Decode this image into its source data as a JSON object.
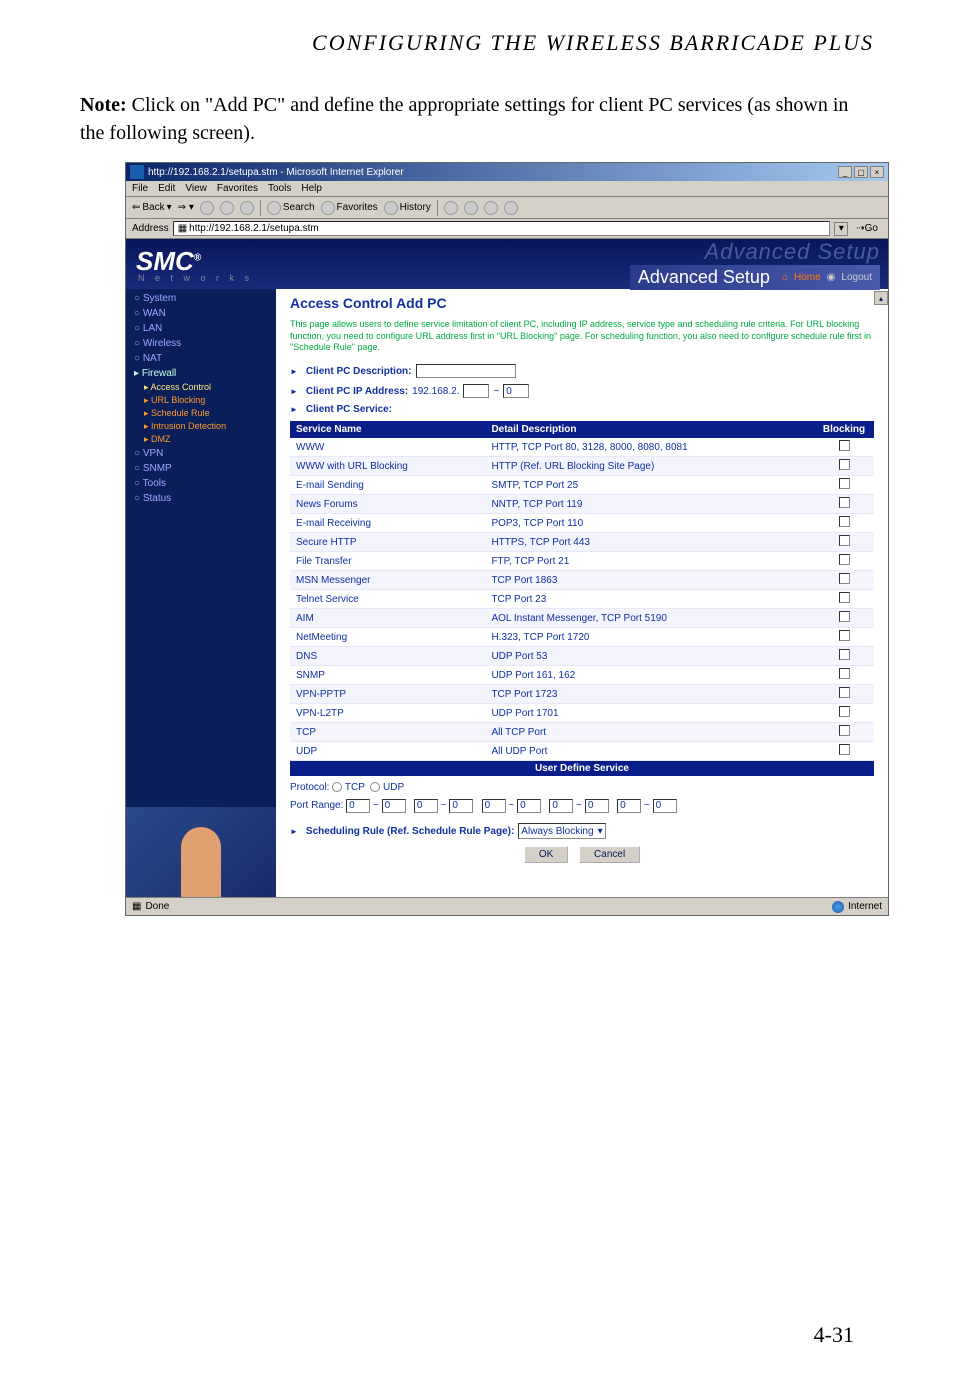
{
  "doc": {
    "header_title": "CONFIGURING THE WIRELESS BARRICADE PLUS",
    "note_label": "Note:",
    "note_text": "Click on \"Add PC\" and define the appropriate settings for client PC services (as shown in the following screen).",
    "page_number": "4-31"
  },
  "browser": {
    "title": "http://192.168.2.1/setupa.stm - Microsoft Internet Explorer",
    "menus": [
      "File",
      "Edit",
      "View",
      "Favorites",
      "Tools",
      "Help"
    ],
    "toolbar": {
      "back": "Back",
      "search": "Search",
      "favorites": "Favorites",
      "history": "History"
    },
    "address_label": "Address",
    "address_value": "http://192.168.2.1/setupa.stm",
    "go_label": "Go",
    "status_done": "Done",
    "status_zone": "Internet"
  },
  "banner": {
    "logo": "SMC",
    "logo_sub": "N e t w o r k s",
    "ghost": "Advanced Setup",
    "title": "Advanced Setup",
    "home": "Home",
    "logout": "Logout"
  },
  "sidebar": {
    "items": [
      {
        "label": "System"
      },
      {
        "label": "WAN"
      },
      {
        "label": "LAN"
      },
      {
        "label": "Wireless"
      },
      {
        "label": "NAT"
      },
      {
        "label": "Firewall"
      }
    ],
    "fw_subs": [
      "Access Control",
      "URL Blocking",
      "Schedule Rule",
      "Intrusion Detection",
      "DMZ"
    ],
    "after": [
      "VPN",
      "SNMP",
      "Tools",
      "Status"
    ]
  },
  "main": {
    "title": "Access Control Add PC",
    "desc": "This page allows users to define service limitation of client PC, including IP address, service type and scheduling rule criteria. For URL blocking function, you need to configure URL address first in \"URL Blocking\" page. For scheduling function, you also need to configure schedule rule first in \"Schedule Rule\" page.",
    "desc_label": "Client PC Description:",
    "ip_label": "Client PC IP Address:",
    "ip_prefix": "192.168.2.",
    "ip_sep": "~",
    "ip_val2": "0",
    "svc_label": "Client PC Service:",
    "col_service": "Service Name",
    "col_detail": "Detail Description",
    "col_block": "Blocking",
    "rows": [
      {
        "name": "WWW",
        "detail": "HTTP, TCP Port 80, 3128, 8000, 8080, 8081"
      },
      {
        "name": "WWW with URL Blocking",
        "detail": "HTTP (Ref. URL Blocking Site Page)"
      },
      {
        "name": "E-mail Sending",
        "detail": "SMTP, TCP Port 25"
      },
      {
        "name": "News Forums",
        "detail": "NNTP, TCP Port 119"
      },
      {
        "name": "E-mail Receiving",
        "detail": "POP3, TCP Port 110"
      },
      {
        "name": "Secure HTTP",
        "detail": "HTTPS, TCP Port 443"
      },
      {
        "name": "File Transfer",
        "detail": "FTP, TCP Port 21"
      },
      {
        "name": "MSN Messenger",
        "detail": "TCP Port 1863"
      },
      {
        "name": "Telnet Service",
        "detail": "TCP Port 23"
      },
      {
        "name": "AIM",
        "detail": "AOL Instant Messenger, TCP Port 5190"
      },
      {
        "name": "NetMeeting",
        "detail": "H.323, TCP Port 1720"
      },
      {
        "name": "DNS",
        "detail": "UDP Port 53"
      },
      {
        "name": "SNMP",
        "detail": "UDP Port 161, 162"
      },
      {
        "name": "VPN-PPTP",
        "detail": "TCP Port 1723"
      },
      {
        "name": "VPN-L2TP",
        "detail": "UDP Port 1701"
      },
      {
        "name": "TCP",
        "detail": "All TCP Port"
      },
      {
        "name": "UDP",
        "detail": "All UDP Port"
      }
    ],
    "uds_title": "User Define Service",
    "proto_label": "Protocol:",
    "proto_tcp": "TCP",
    "proto_udp": "UDP",
    "port_label": "Port Range:",
    "port_val": "0",
    "sched_label": "Scheduling Rule (Ref. Schedule Rule Page):",
    "sched_value": "Always Blocking",
    "ok": "OK",
    "cancel": "Cancel"
  }
}
